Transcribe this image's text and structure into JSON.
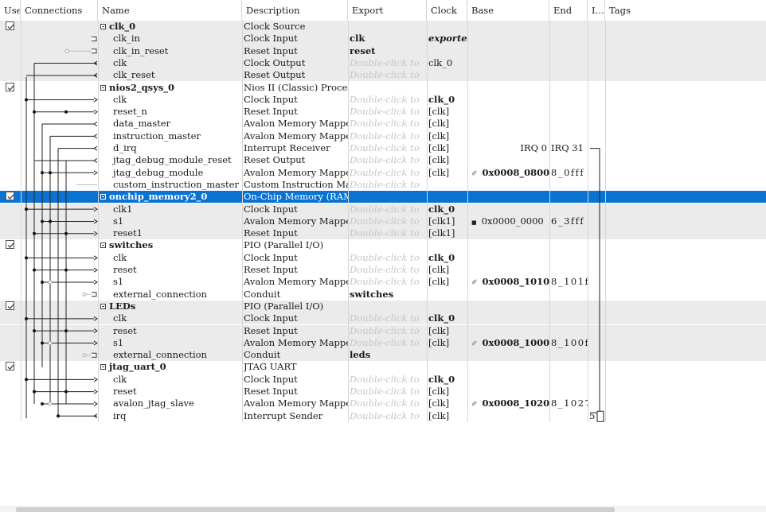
{
  "columns": {
    "use": "Use",
    "connections": "Connections",
    "name": "Name",
    "description": "Description",
    "export": "Export",
    "clock": "Clock",
    "base": "Base",
    "end": "End",
    "irq": "I...",
    "tags": "Tags"
  },
  "placeholder": "Double-click to",
  "rows": [
    {
      "kind": "module",
      "use": true,
      "name": "clk_0",
      "desc": "Clock Source",
      "export": "",
      "clock": "",
      "base": "",
      "end": "",
      "irq": ""
    },
    {
      "kind": "port",
      "name": "clk_in",
      "desc": "Clock Input",
      "export": "clk",
      "export_bold": true,
      "clock": "exported",
      "clock_style": "exported",
      "base": "",
      "end": "",
      "irq": ""
    },
    {
      "kind": "port",
      "name": "clk_in_reset",
      "desc": "Reset Input",
      "export": "reset",
      "export_bold": true,
      "clock": "",
      "base": "",
      "end": "",
      "irq": ""
    },
    {
      "kind": "port",
      "name": "clk",
      "desc": "Clock Output",
      "export": "@placeholder",
      "clock": "clk_0",
      "base": "",
      "end": "",
      "irq": ""
    },
    {
      "kind": "port",
      "name": "clk_reset",
      "desc": "Reset Output",
      "export": "@placeholder",
      "clock": "",
      "base": "",
      "end": "",
      "irq": ""
    },
    {
      "kind": "module",
      "use": true,
      "name": "nios2_qsys_0",
      "desc": "Nios II (Classic) Processor",
      "export": "",
      "clock": "",
      "base": "",
      "end": "",
      "irq": ""
    },
    {
      "kind": "port",
      "name": "clk",
      "desc": "Clock Input",
      "export": "@placeholder",
      "clock": "clk_0",
      "clock_bold": true,
      "base": "",
      "end": "",
      "irq": ""
    },
    {
      "kind": "port",
      "name": "reset_n",
      "desc": "Reset Input",
      "export": "@placeholder",
      "clock": "[clk]",
      "base": "",
      "end": "",
      "irq": ""
    },
    {
      "kind": "port",
      "name": "data_master",
      "desc": "Avalon Memory Mapped ...",
      "export": "@placeholder",
      "clock": "[clk]",
      "base": "",
      "end": "",
      "irq": ""
    },
    {
      "kind": "port",
      "name": "instruction_master",
      "desc": "Avalon Memory Mapped ...",
      "export": "@placeholder",
      "clock": "[clk]",
      "base": "",
      "end": "",
      "irq": ""
    },
    {
      "kind": "port",
      "name": "d_irq",
      "desc": "Interrupt Receiver",
      "export": "@placeholder",
      "clock": "[clk]",
      "base": "IRQ 0",
      "base_align": "right",
      "end": "IRQ 31",
      "irq": ""
    },
    {
      "kind": "port",
      "name": "jtag_debug_module_reset",
      "desc": "Reset Output",
      "export": "@placeholder",
      "clock": "[clk]",
      "base": "",
      "end": "",
      "irq": ""
    },
    {
      "kind": "port",
      "name": "jtag_debug_module",
      "desc": "Avalon Memory Mapped ...",
      "export": "@placeholder",
      "clock": "[clk]",
      "base": "0x0008_0800",
      "base_bold": true,
      "end": "8_0fff",
      "irq": ""
    },
    {
      "kind": "port",
      "name": "custom_instruction_master",
      "desc": "Custom Instruction Master",
      "export": "@placeholder",
      "clock": "",
      "base": "",
      "end": "",
      "irq": ""
    },
    {
      "kind": "module",
      "use": true,
      "selected": true,
      "name": "onchip_memory2_0",
      "desc": "On-Chip Memory (RAM o...",
      "export": "",
      "clock": "",
      "base": "",
      "end": "",
      "irq": ""
    },
    {
      "kind": "port",
      "name": "clk1",
      "desc": "Clock Input",
      "export": "@placeholder",
      "clock": "clk_0",
      "clock_bold": true,
      "base": "",
      "end": "",
      "irq": ""
    },
    {
      "kind": "port",
      "name": "s1",
      "desc": "Avalon Memory Mapped ...",
      "export": "@placeholder",
      "clock": "[clk1]",
      "base": "0x0000_0000",
      "base_lock": true,
      "end": "6_3fff",
      "irq": ""
    },
    {
      "kind": "port",
      "name": "reset1",
      "desc": "Reset Input",
      "export": "@placeholder",
      "clock": "[clk1]",
      "base": "",
      "end": "",
      "irq": ""
    },
    {
      "kind": "module",
      "use": true,
      "name": "switches",
      "desc": "PIO (Parallel I/O)",
      "export": "",
      "clock": "",
      "base": "",
      "end": "",
      "irq": ""
    },
    {
      "kind": "port",
      "name": "clk",
      "desc": "Clock Input",
      "export": "@placeholder",
      "clock": "clk_0",
      "clock_bold": true,
      "base": "",
      "end": "",
      "irq": ""
    },
    {
      "kind": "port",
      "name": "reset",
      "desc": "Reset Input",
      "export": "@placeholder",
      "clock": "[clk]",
      "base": "",
      "end": "",
      "irq": ""
    },
    {
      "kind": "port",
      "name": "s1",
      "desc": "Avalon Memory Mapped ...",
      "export": "@placeholder",
      "clock": "[clk]",
      "base": "0x0008_1010",
      "base_bold": true,
      "end": "8_101f",
      "irq": ""
    },
    {
      "kind": "port",
      "name": "external_connection",
      "desc": "Conduit",
      "export": "switches",
      "export_bold": true,
      "clock": "",
      "base": "",
      "end": "",
      "irq": ""
    },
    {
      "kind": "module",
      "use": true,
      "name": "LEDs",
      "desc": "PIO (Parallel I/O)",
      "export": "",
      "clock": "",
      "base": "",
      "end": "",
      "irq": ""
    },
    {
      "kind": "port",
      "name": "clk",
      "desc": "Clock Input",
      "export": "@placeholder",
      "clock": "clk_0",
      "clock_bold": true,
      "base": "",
      "end": "",
      "irq": ""
    },
    {
      "kind": "port",
      "name": "reset",
      "desc": "Reset Input",
      "export": "@placeholder",
      "clock": "[clk]",
      "base": "",
      "end": "",
      "irq": ""
    },
    {
      "kind": "port",
      "name": "s1",
      "desc": "Avalon Memory Mapped ...",
      "export": "@placeholder",
      "clock": "[clk]",
      "base": "0x0008_1000",
      "base_bold": true,
      "end": "8_100f",
      "irq": ""
    },
    {
      "kind": "port",
      "name": "external_connection",
      "desc": "Conduit",
      "export": "leds",
      "export_bold": true,
      "clock": "",
      "base": "",
      "end": "",
      "irq": ""
    },
    {
      "kind": "module",
      "use": true,
      "name": "jtag_uart_0",
      "desc": "JTAG UART",
      "export": "",
      "clock": "",
      "base": "",
      "end": "",
      "irq": ""
    },
    {
      "kind": "port",
      "name": "clk",
      "desc": "Clock Input",
      "export": "@placeholder",
      "clock": "clk_0",
      "clock_bold": true,
      "base": "",
      "end": "",
      "irq": ""
    },
    {
      "kind": "port",
      "name": "reset",
      "desc": "Reset Input",
      "export": "@placeholder",
      "clock": "[clk]",
      "base": "",
      "end": "",
      "irq": ""
    },
    {
      "kind": "port",
      "name": "avalon_jtag_slave",
      "desc": "Avalon Memory Mapped ...",
      "export": "@placeholder",
      "clock": "[clk]",
      "base": "0x0008_1020",
      "base_bold": true,
      "end": "8_1027",
      "irq": ""
    },
    {
      "kind": "port",
      "name": "irq",
      "desc": "Interrupt Sender",
      "export": "@placeholder",
      "clock": "[clk]",
      "base": "",
      "end": "",
      "irq": "5"
    }
  ],
  "colors": {
    "selection": "#0a73d1",
    "grey_row": "#ebebeb",
    "placeholder": "#c6c6c6"
  }
}
